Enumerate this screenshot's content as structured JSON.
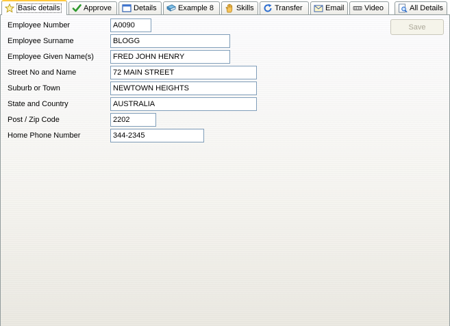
{
  "tabs": [
    {
      "label": "Basic details",
      "icon": "star-icon",
      "active": true
    },
    {
      "label": "Approve",
      "icon": "checkmark-icon"
    },
    {
      "label": "Details",
      "icon": "window-icon"
    },
    {
      "label": "Example 8",
      "icon": "book-icon"
    },
    {
      "label": "Skills",
      "icon": "hand-icon"
    },
    {
      "label": "Transfer",
      "icon": "refresh-icon"
    },
    {
      "label": "Email",
      "icon": "envelope-icon"
    },
    {
      "label": "Video",
      "icon": "film-icon"
    },
    {
      "label": "All Details",
      "icon": "document-search-icon"
    }
  ],
  "toolbar": {
    "save_label": "Save"
  },
  "form": {
    "fields": [
      {
        "label": "Employee Number",
        "value": "A0090"
      },
      {
        "label": "Employee Surname",
        "value": "BLOGG"
      },
      {
        "label": "Employee Given Name(s)",
        "value": "FRED JOHN HENRY"
      },
      {
        "label": "Street No and Name",
        "value": "72 MAIN STREET"
      },
      {
        "label": "Suburb or Town",
        "value": "NEWTOWN HEIGHTS"
      },
      {
        "label": "State and Country",
        "value": "AUSTRALIA"
      },
      {
        "label": "Post / Zip Code",
        "value": "2202"
      },
      {
        "label": "Home Phone Number",
        "value": "344-2345"
      }
    ]
  },
  "colors": {
    "active_tab_accent": "#ffc83c",
    "border": "#919b9c",
    "input_border": "#7f9db9",
    "disabled_text": "#aca899"
  }
}
